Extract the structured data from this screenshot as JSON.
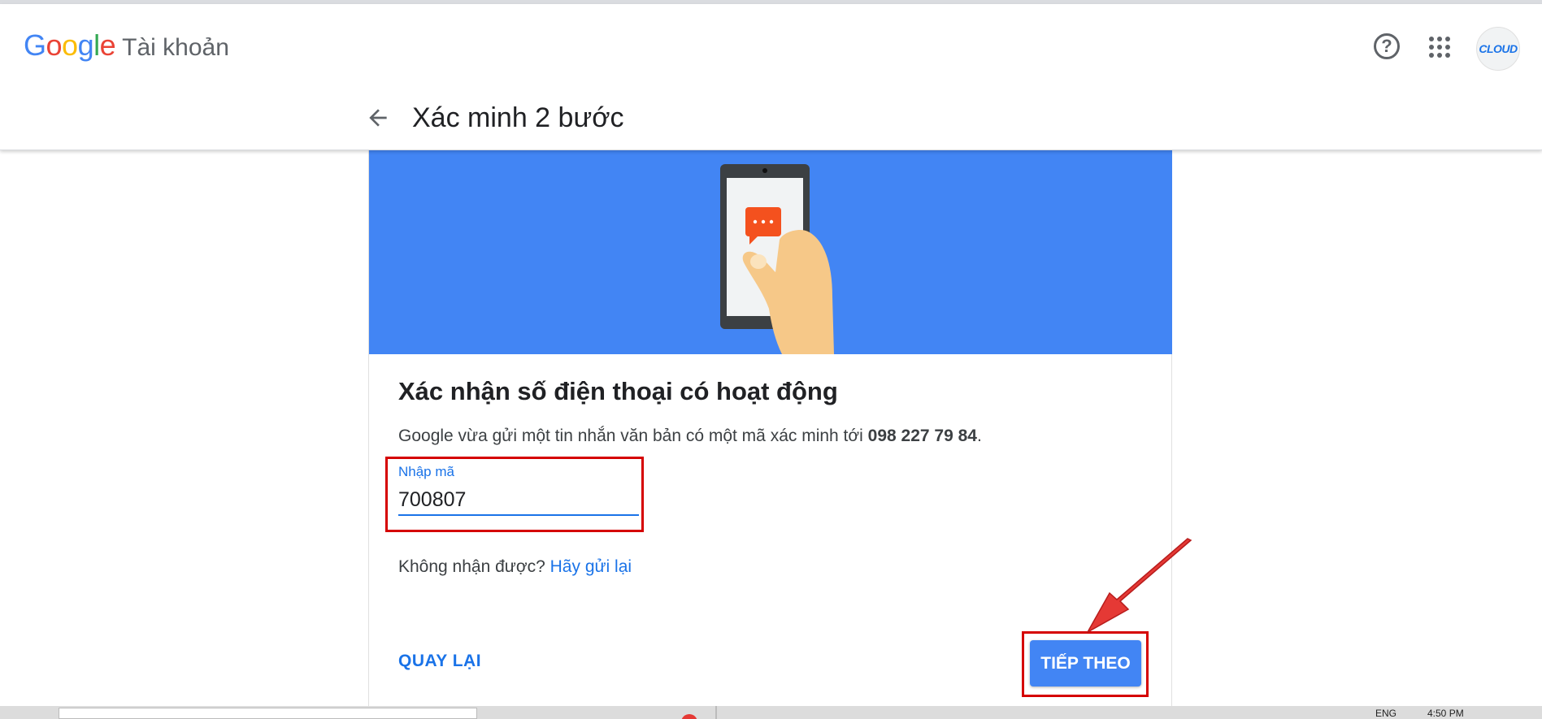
{
  "header": {
    "logo_letters": [
      "G",
      "o",
      "o",
      "g",
      "l",
      "e"
    ],
    "product_name": "Tài khoản",
    "help_icon": "help-circle-icon",
    "apps_icon": "apps-grid-icon",
    "avatar_text": "CLOUD",
    "page_title": "Xác minh 2 bước"
  },
  "card": {
    "banner_color": "#4285f4",
    "heading": "Xác nhận số điện thoại có hoạt động",
    "description_prefix": "Google vừa gửi một tin nhắn văn bản có một mã xác minh tới ",
    "phone_number": "098 227 79 84",
    "description_suffix": ".",
    "code_label": "Nhập mã",
    "code_value": "700807",
    "resend_prefix": "Không nhận được? ",
    "resend_link": "Hãy gửi lại",
    "back_button": "QUAY LẠI",
    "next_button": "TIẾP THEO"
  },
  "taskbar": {
    "lang": "ENG",
    "time": "4:50 PM"
  },
  "colors": {
    "accent": "#1a73e8",
    "button": "#4285f4",
    "highlight": "#d50000"
  }
}
